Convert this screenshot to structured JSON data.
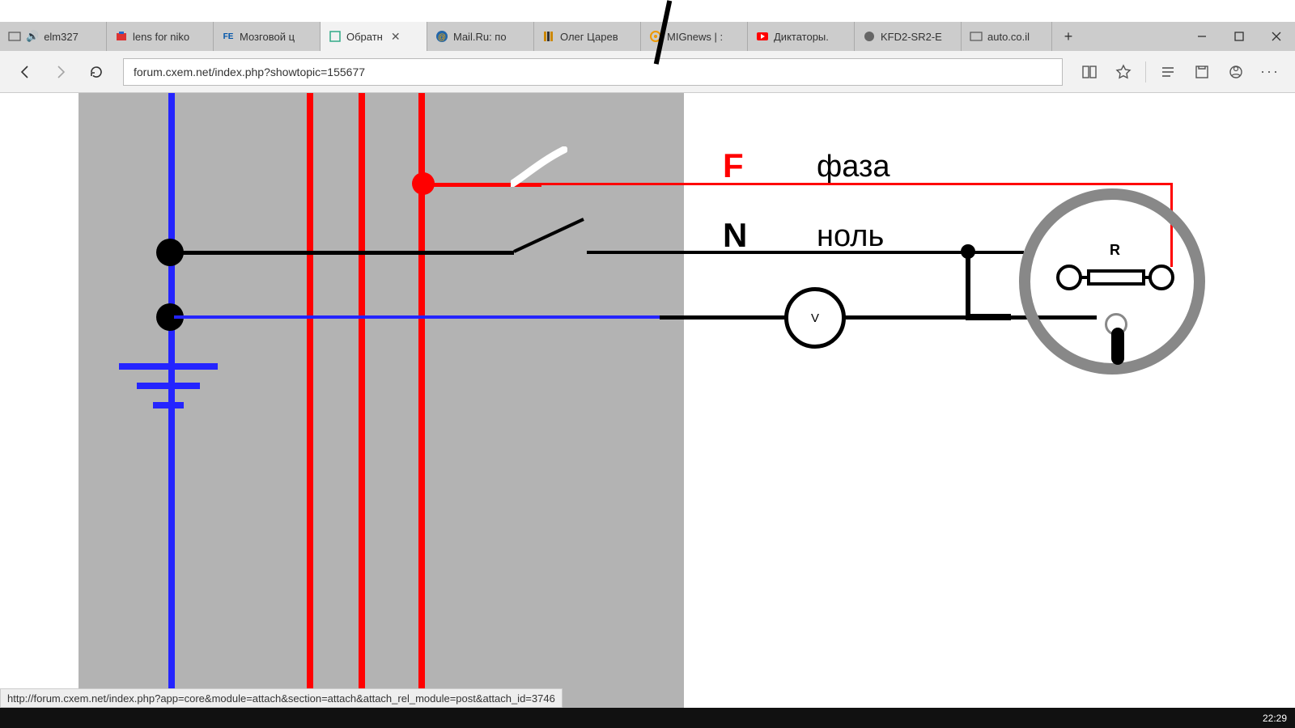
{
  "tabs": [
    {
      "label": "elm327"
    },
    {
      "label": "lens for niko"
    },
    {
      "label": "Мозговой ц"
    },
    {
      "label": "Обратн",
      "active": true
    },
    {
      "label": "Mail.Ru: по"
    },
    {
      "label": "Олег Царев"
    },
    {
      "label": "MIGnews | :"
    },
    {
      "label": "Диктаторы."
    },
    {
      "label": "KFD2-SR2-E"
    },
    {
      "label": "auto.co.il"
    }
  ],
  "url": "forum.cxem.net/index.php?showtopic=155677",
  "status_url": "http://forum.cxem.net/index.php?app=core&module=attach&section=attach&attach_rel_module=post&attach_id=3746",
  "clock": "22:29",
  "diagram": {
    "F_letter": "F",
    "F_label": "фаза",
    "N_letter": "N",
    "N_label": "ноль",
    "V_label": "V",
    "R_label": "R"
  }
}
